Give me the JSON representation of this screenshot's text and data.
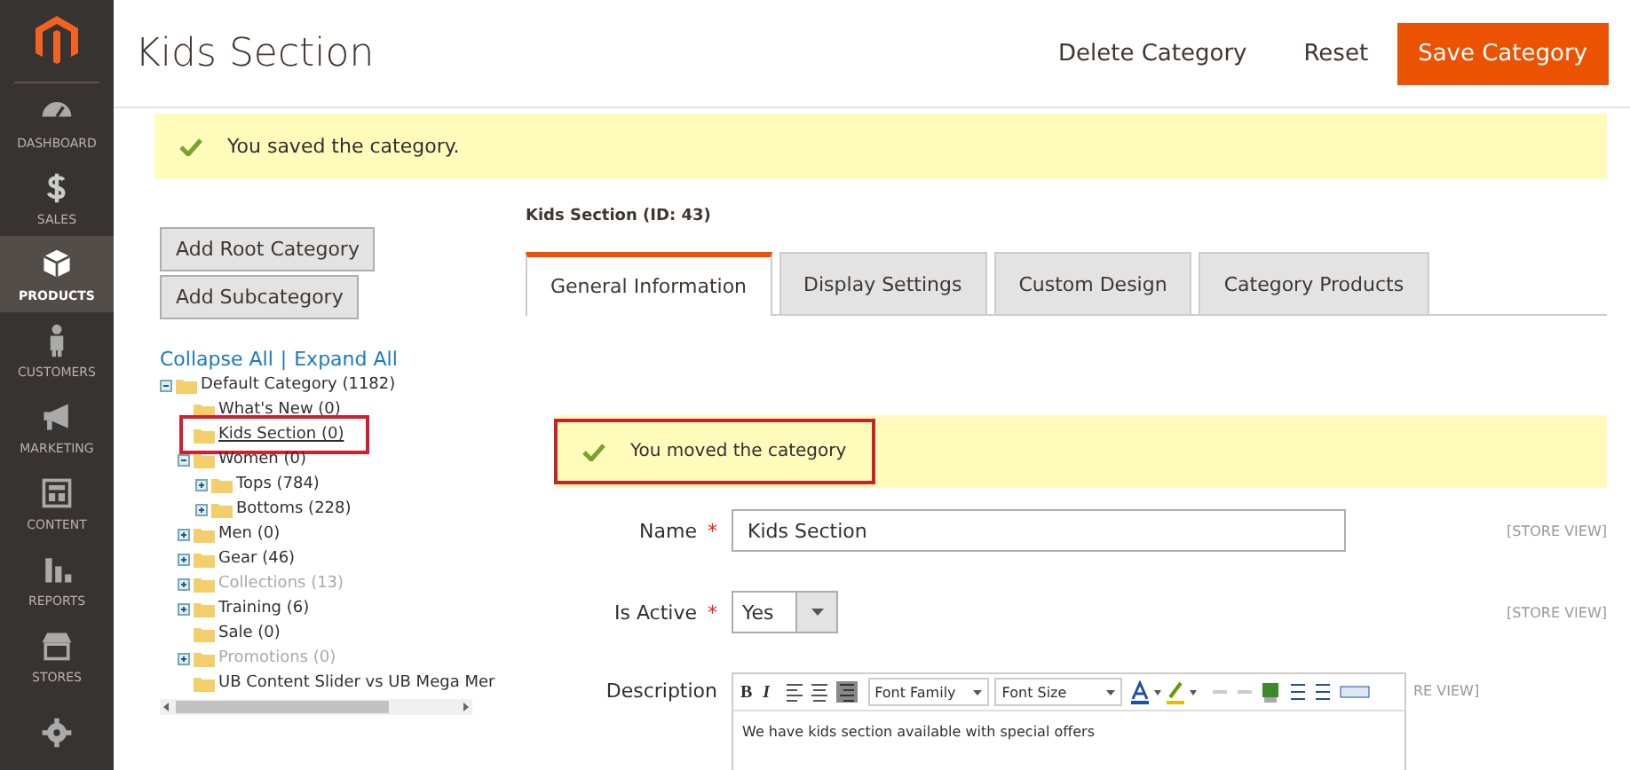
{
  "sidebar": {
    "items": [
      {
        "kind": "dashboard",
        "label": "DASHBOARD",
        "selected": false
      },
      {
        "kind": "sales",
        "label": "SALES",
        "selected": false
      },
      {
        "kind": "products",
        "label": "PRODUCTS",
        "selected": true
      },
      {
        "kind": "customers",
        "label": "CUSTOMERS",
        "selected": false
      },
      {
        "kind": "marketing",
        "label": "MARKETING",
        "selected": false
      },
      {
        "kind": "content",
        "label": "CONTENT",
        "selected": false
      },
      {
        "kind": "reports",
        "label": "REPORTS",
        "selected": false
      },
      {
        "kind": "stores",
        "label": "STORES",
        "selected": false
      },
      {
        "kind": "system",
        "selected": false
      }
    ]
  },
  "header": {
    "title": "Kids Section",
    "buttons": [
      {
        "kind": "plain",
        "label": "Delete Category"
      },
      {
        "kind": "plain",
        "label": "Reset"
      },
      {
        "kind": "primary",
        "label": "Save Category"
      }
    ]
  },
  "message": {
    "text": "You saved the category."
  },
  "tree_panel": {
    "buttons": [
      "Add Root Category",
      "Add Subcategory"
    ],
    "collapse": "Collapse All",
    "separator": "|",
    "expand": "Expand All",
    "tree": [
      {
        "label": "Default Category (1182)",
        "expanded": true,
        "disabled": false,
        "selected": false,
        "children": [
          {
            "label": "What's New (0)",
            "disabled": false,
            "selected": false
          },
          {
            "label": "Kids Section (0)",
            "disabled": false,
            "selected": true
          },
          {
            "label": "Women (0)",
            "expanded": true,
            "disabled": false,
            "selected": false,
            "children": [
              {
                "label": "Tops (784)",
                "expanded": false,
                "disabled": false,
                "selected": false
              },
              {
                "label": "Bottoms (228)",
                "expanded": false,
                "disabled": false,
                "selected": false
              }
            ]
          },
          {
            "label": "Men (0)",
            "expanded": false,
            "disabled": false,
            "selected": false
          },
          {
            "label": "Gear (46)",
            "expanded": false,
            "disabled": false,
            "selected": false
          },
          {
            "label": "Collections (13)",
            "expanded": false,
            "disabled": true,
            "selected": false
          },
          {
            "label": "Training (6)",
            "expanded": false,
            "disabled": false,
            "selected": false
          },
          {
            "label": "Sale (0)",
            "disabled": false,
            "selected": false
          },
          {
            "label": "Promotions (0)",
            "expanded": false,
            "disabled": true,
            "selected": false
          },
          {
            "label": "UB Content Slider vs UB Mega Mer",
            "disabled": false,
            "selected": false
          }
        ]
      }
    ]
  },
  "editor": {
    "heading": "Kids Section (ID: 43)",
    "tabs": [
      {
        "label": "General Information",
        "selected": true
      },
      {
        "label": "Display Settings",
        "selected": false
      },
      {
        "label": "Custom Design",
        "selected": false
      },
      {
        "label": "Category Products",
        "selected": false
      }
    ],
    "notice": {
      "text": "You moved the category"
    },
    "fields": [
      {
        "kind": "text",
        "label": "Name",
        "required_mark": "*",
        "value": "Kids Section",
        "scope": "[STORE VIEW]"
      },
      {
        "kind": "select",
        "label": "Is Active",
        "required_mark": "*",
        "value": "Yes",
        "scope": "[STORE VIEW]"
      },
      {
        "kind": "wysiwyg",
        "label": "Description",
        "value": "We have kids section available with special offers",
        "scope": "RE VIEW]",
        "toolbar": {
          "bold": "B",
          "italic": "I",
          "font_family": "Font Family",
          "font_size": "Font Size"
        }
      }
    ]
  }
}
